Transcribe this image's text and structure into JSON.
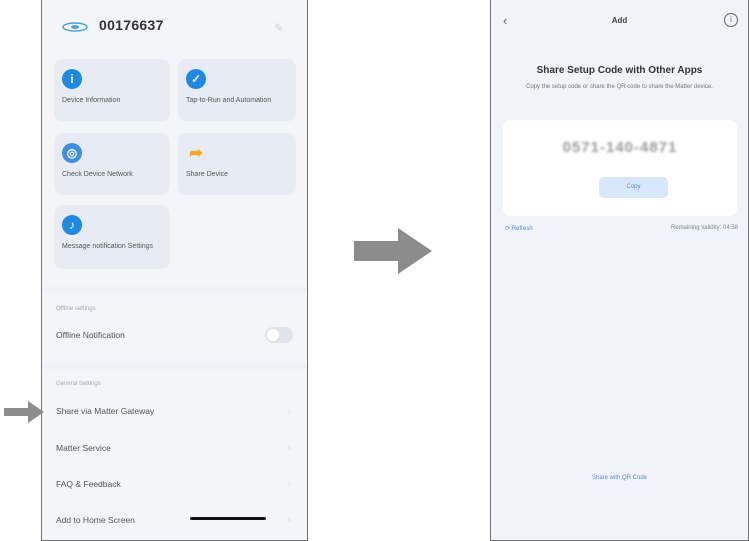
{
  "left_screen": {
    "device_id": "00176637",
    "tiles": [
      {
        "label": "Device Information",
        "icon": "info-icon",
        "color": "#1e88e5"
      },
      {
        "label": "Tap-to-Run and Automation",
        "icon": "checkmark-icon",
        "color": "#1e88e5"
      },
      {
        "label": "Check Device Network",
        "icon": "network-icon",
        "color": "#3f8fe0"
      },
      {
        "label": "Share Device",
        "icon": "share-icon",
        "color": "#f5a623"
      },
      {
        "label": "Message notification Settings",
        "icon": "bell-icon",
        "color": "#1e88e5"
      }
    ],
    "offline_section_label": "Offline settings",
    "offline_row": "Offline Notification",
    "general_section_label": "General Settings",
    "rows": [
      "Share via Matter Gateway",
      "Matter Service",
      "FAQ & Feedback",
      "Add to Home Screen"
    ]
  },
  "right_screen": {
    "title": "Add",
    "heading": "Share Setup Code with Other Apps",
    "subtext": "Copy the setup code or share the QR code to share the Matter device.",
    "code": "0571-140-4871",
    "copy_label": "Copy",
    "refresh_label": "Refresh",
    "validity_label": "Remaining validity: 04:58",
    "qr_link": "Share with QR Code"
  },
  "colors": {
    "accent": "#5b8bd1",
    "arrow": "#8c8c8c"
  }
}
